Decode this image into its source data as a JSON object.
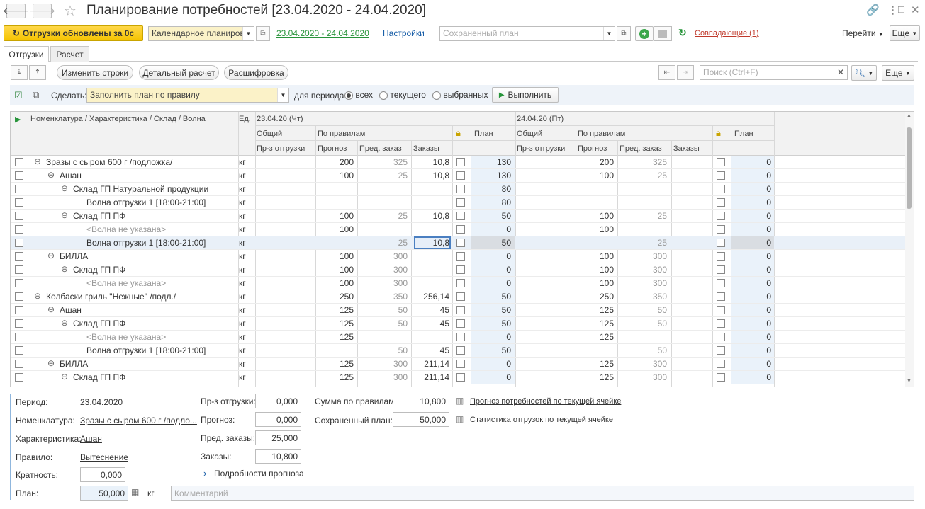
{
  "window": {
    "title": "Планирование потребностей [23.04.2020 - 24.04.2020]",
    "nav_back": "🡐",
    "nav_forward": "🡒",
    "icons": [
      "link-icon",
      "more-icon",
      "maximize-icon",
      "close-icon"
    ]
  },
  "toolbar": {
    "shipments_button": "Отгрузки обновлены за 0с",
    "planning_mode": "Календарное планирова",
    "period_link": "23.04.2020 - 24.04.2020",
    "settings_link": "Настройки",
    "saved_plan_placeholder": "Сохраненный план",
    "matches_link": "Совпадающие (1)",
    "goto_menu": "Перейти",
    "more_menu": "Еще"
  },
  "tabs": [
    {
      "label": "Отгрузки",
      "active": true
    },
    {
      "label": "Расчет",
      "active": false
    }
  ],
  "actions": {
    "change_rows": "Изменить строки",
    "detailed_calc": "Детальный расчет",
    "decoding": "Расшифровка",
    "search_placeholder": "Поиск (Ctrl+F)",
    "more_menu": "Еще"
  },
  "rule_bar": {
    "do_label": "Сделать:",
    "rule_value": "Заполнить план по правилу",
    "period_label": "для периода:",
    "options": [
      "всех",
      "текущего",
      "выбранных"
    ],
    "selected_option": "всех",
    "execute_button": "Выполнить"
  },
  "grid_header": {
    "name_col": "Номенклатура / Характеристика / Склад / Волна",
    "unit_col": "Ед.",
    "day1": "23.04.20 (Чт)",
    "day2": "24.04.20 (Пт)",
    "general": "Общий",
    "by_rules": "По правилам",
    "plan": "План",
    "shipment_sub": "Пр-з отгрузки",
    "forecast_sub": "Прогноз",
    "prev_order_sub": "Пред. заказ",
    "orders_sub": "Заказы"
  },
  "rows": [
    {
      "level": 0,
      "name": "Зразы с сыром  600 г /подложка/",
      "expander": "⊖",
      "unit": "кг",
      "d1_forecast": "200",
      "d1_prev": "325",
      "d1_orders": "10,8",
      "d1_plan": "130",
      "d2_forecast": "200",
      "d2_prev": "325",
      "d2_orders": "",
      "d2_plan": "0"
    },
    {
      "level": 1,
      "name": "Ашан",
      "expander": "⊖",
      "unit": "кг",
      "d1_forecast": "100",
      "d1_prev": "25",
      "d1_orders": "10,8",
      "d1_plan": "130",
      "d2_forecast": "100",
      "d2_prev": "25",
      "d2_orders": "",
      "d2_plan": "0"
    },
    {
      "level": 2,
      "name": "Склад ГП Натуральной продукции",
      "expander": "⊖",
      "unit": "кг",
      "d1_forecast": "",
      "d1_prev": "",
      "d1_orders": "",
      "d1_plan": "80",
      "d2_forecast": "",
      "d2_prev": "",
      "d2_orders": "",
      "d2_plan": "0"
    },
    {
      "level": 3,
      "name": "Волна отгрузки 1 [18:00-21:00]",
      "expander": "",
      "unit": "кг",
      "d1_forecast": "",
      "d1_prev": "",
      "d1_orders": "",
      "d1_plan": "80",
      "d2_forecast": "",
      "d2_prev": "",
      "d2_orders": "",
      "d2_plan": "0"
    },
    {
      "level": 2,
      "name": "Склад ГП ПФ",
      "expander": "⊖",
      "unit": "кг",
      "d1_forecast": "100",
      "d1_prev": "25",
      "d1_orders": "10,8",
      "d1_plan": "50",
      "d2_forecast": "100",
      "d2_prev": "25",
      "d2_orders": "",
      "d2_plan": "0"
    },
    {
      "level": 3,
      "name": "<Волна не указана>",
      "expander": "",
      "gray": true,
      "unit": "кг",
      "d1_forecast": "100",
      "d1_prev": "",
      "d1_orders": "",
      "d1_plan": "0",
      "d2_forecast": "100",
      "d2_prev": "",
      "d2_orders": "",
      "d2_plan": "0"
    },
    {
      "level": 3,
      "name": "Волна отгрузки 1 [18:00-21:00]",
      "expander": "",
      "selected": true,
      "unit": "кг",
      "d1_forecast": "",
      "d1_prev": "25",
      "d1_orders": "10,8",
      "d1_plan": "50",
      "d2_forecast": "",
      "d2_prev": "25",
      "d2_orders": "",
      "d2_plan": "0"
    },
    {
      "level": 1,
      "name": "БИЛЛА",
      "expander": "⊖",
      "unit": "кг",
      "d1_forecast": "100",
      "d1_prev": "300",
      "d1_orders": "",
      "d1_plan": "0",
      "d2_forecast": "100",
      "d2_prev": "300",
      "d2_orders": "",
      "d2_plan": "0"
    },
    {
      "level": 2,
      "name": "Склад ГП ПФ",
      "expander": "⊖",
      "unit": "кг",
      "d1_forecast": "100",
      "d1_prev": "300",
      "d1_orders": "",
      "d1_plan": "0",
      "d2_forecast": "100",
      "d2_prev": "300",
      "d2_orders": "",
      "d2_plan": "0"
    },
    {
      "level": 3,
      "name": "<Волна не указана>",
      "expander": "",
      "gray": true,
      "unit": "кг",
      "d1_forecast": "100",
      "d1_prev": "300",
      "d1_orders": "",
      "d1_plan": "0",
      "d2_forecast": "100",
      "d2_prev": "300",
      "d2_orders": "",
      "d2_plan": "0"
    },
    {
      "level": 0,
      "name": "Колбаски гриль \"Нежные\" /подл./",
      "expander": "⊖",
      "unit": "кг",
      "d1_forecast": "250",
      "d1_prev": "350",
      "d1_orders": "256,14",
      "d1_plan": "50",
      "d2_forecast": "250",
      "d2_prev": "350",
      "d2_orders": "",
      "d2_plan": "0"
    },
    {
      "level": 1,
      "name": "Ашан",
      "expander": "⊖",
      "unit": "кг",
      "d1_forecast": "125",
      "d1_prev": "50",
      "d1_orders": "45",
      "d1_plan": "50",
      "d2_forecast": "125",
      "d2_prev": "50",
      "d2_orders": "",
      "d2_plan": "0"
    },
    {
      "level": 2,
      "name": "Склад ГП ПФ",
      "expander": "⊖",
      "unit": "кг",
      "d1_forecast": "125",
      "d1_prev": "50",
      "d1_orders": "45",
      "d1_plan": "50",
      "d2_forecast": "125",
      "d2_prev": "50",
      "d2_orders": "",
      "d2_plan": "0"
    },
    {
      "level": 3,
      "name": "<Волна не указана>",
      "expander": "",
      "gray": true,
      "unit": "кг",
      "d1_forecast": "125",
      "d1_prev": "",
      "d1_orders": "",
      "d1_plan": "0",
      "d2_forecast": "125",
      "d2_prev": "",
      "d2_orders": "",
      "d2_plan": "0"
    },
    {
      "level": 3,
      "name": "Волна отгрузки 1 [18:00-21:00]",
      "expander": "",
      "unit": "кг",
      "d1_forecast": "",
      "d1_prev": "50",
      "d1_orders": "45",
      "d1_plan": "50",
      "d2_forecast": "",
      "d2_prev": "50",
      "d2_orders": "",
      "d2_plan": "0"
    },
    {
      "level": 1,
      "name": "БИЛЛА",
      "expander": "⊖",
      "unit": "кг",
      "d1_forecast": "125",
      "d1_prev": "300",
      "d1_orders": "211,14",
      "d1_plan": "0",
      "d2_forecast": "125",
      "d2_prev": "300",
      "d2_orders": "",
      "d2_plan": "0"
    },
    {
      "level": 2,
      "name": "Склад ГП ПФ",
      "expander": "⊖",
      "unit": "кг",
      "d1_forecast": "125",
      "d1_prev": "300",
      "d1_orders": "211,14",
      "d1_plan": "0",
      "d2_forecast": "125",
      "d2_prev": "300",
      "d2_orders": "",
      "d2_plan": "0"
    }
  ],
  "details": {
    "period_label": "Период:",
    "period_value": "23.04.2020",
    "nomenclature_label": "Номенклатура:",
    "nomenclature_value": "Зразы с сыром  600 г /подло...",
    "characteristic_label": "Характеристика:",
    "characteristic_value": "Ашан",
    "rule_label": "Правило:",
    "rule_value": "Вытеснение",
    "multiplicity_label": "Кратность:",
    "multiplicity_value": "0,000",
    "plan_label": "План:",
    "plan_value": "50,000",
    "plan_unit": "кг",
    "comment_placeholder": "Комментарий",
    "shipment_label": "Пр-з отгрузки:",
    "shipment_value": "0,000",
    "forecast_label": "Прогноз:",
    "forecast_value": "0,000",
    "prev_orders_label": "Пред. заказы:",
    "prev_orders_value": "25,000",
    "orders_label": "Заказы:",
    "orders_value": "10,800",
    "forecast_details": "Подробности прогноза",
    "sum_rules_label": "Сумма по правилам:",
    "sum_rules_value": "10,800",
    "saved_plan_label": "Сохраненный план:",
    "saved_plan_value": "50,000",
    "forecast_link": "Прогноз потребностей по текущей ячейке",
    "stats_link": "Статистика отгрузок по текущей ячейке"
  },
  "colors": {
    "accent_yellow": "#f5c300",
    "link_blue": "#1a5fa8",
    "green": "#27943a",
    "plan_cell_bg": "#eaf2fa"
  }
}
